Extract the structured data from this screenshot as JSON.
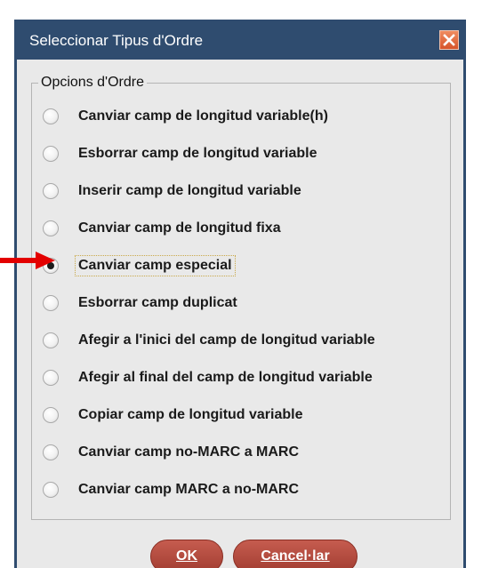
{
  "dialog": {
    "title": "Seleccionar Tipus d'Ordre",
    "group_legend": "Opcions d'Ordre",
    "options": [
      {
        "label": "Canviar camp de longitud variable(h)",
        "checked": false
      },
      {
        "label": "Esborrar camp de longitud variable",
        "checked": false
      },
      {
        "label": "Inserir camp de longitud variable",
        "checked": false
      },
      {
        "label": "Canviar camp de longitud fixa",
        "checked": false
      },
      {
        "label": "Canviar camp especial",
        "checked": true
      },
      {
        "label": "Esborrar camp duplicat",
        "checked": false
      },
      {
        "label": "Afegir a l'inici del camp de longitud variable",
        "checked": false
      },
      {
        "label": "Afegir al final del camp de longitud variable",
        "checked": false
      },
      {
        "label": "Copiar camp de longitud variable",
        "checked": false
      },
      {
        "label": "Canviar camp no-MARC a MARC",
        "checked": false
      },
      {
        "label": "Canviar camp MARC a no-MARC",
        "checked": false
      }
    ],
    "ok_label": "OK",
    "cancel_label": "Cancel·lar"
  },
  "icons": {
    "close": "close-icon",
    "annotation": "red-arrow-icon"
  },
  "colors": {
    "titlebar": "#2f4c6f",
    "close_button": "#d6542a",
    "button": "#a23d31",
    "annotation_arrow": "#e30000"
  }
}
